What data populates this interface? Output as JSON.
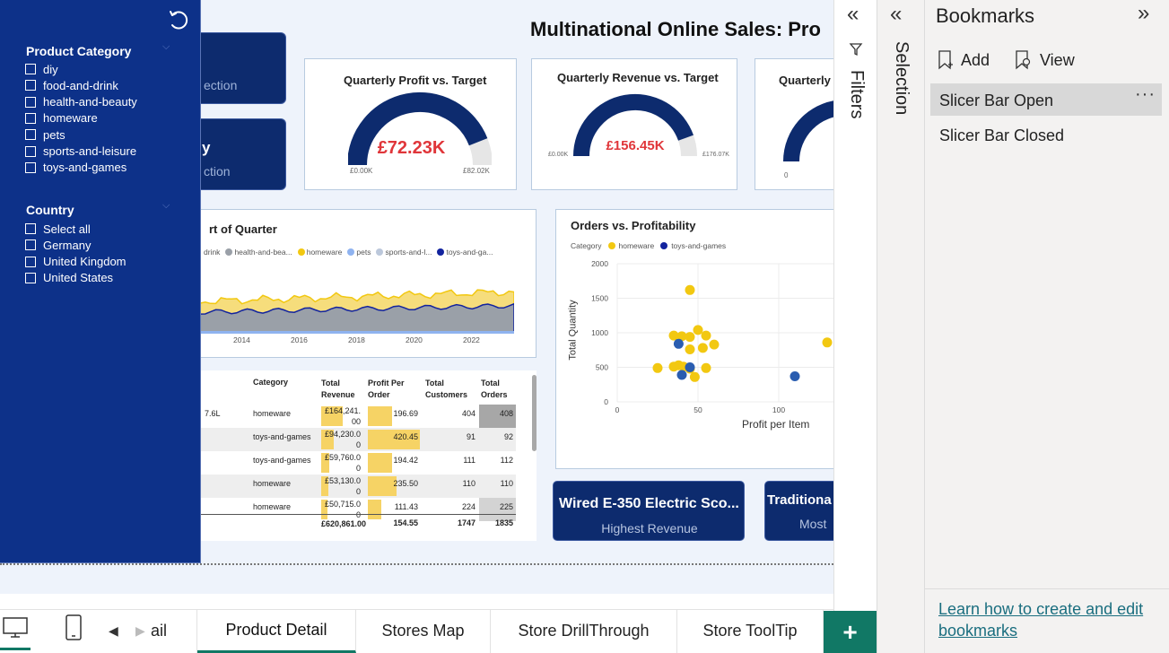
{
  "report": {
    "title_visible": "Multinational Online Sales: Pro",
    "nav_btn1_text": "ection",
    "nav_btn2_big": "y",
    "nav_btn2_text": "ction"
  },
  "slicer": {
    "category_title": "Product Category",
    "categories": [
      "diy",
      "food-and-drink",
      "health-and-beauty",
      "homeware",
      "pets",
      "sports-and-leisure",
      "toys-and-games"
    ],
    "country_title": "Country",
    "countries": [
      "Select all",
      "Germany",
      "United Kingdom",
      "United States"
    ]
  },
  "gauges": [
    {
      "title": "Quarterly Profit vs. Target",
      "value": "£72.23K",
      "min": "£0.00K",
      "max": "£82.02K",
      "fraction": 0.88
    },
    {
      "title": "Quarterly Revenue vs. Target",
      "value": "£156.45K",
      "min": "£0.00K",
      "max": "£176.07K",
      "fraction": 0.89
    },
    {
      "title": "Quarterly",
      "min": "0",
      "fraction": 0.5
    }
  ],
  "area_chart": {
    "title_visible": "rt of Quarter",
    "legend": [
      "drink",
      "health-and-bea...",
      "homeware",
      "pets",
      "sports-and-l...",
      "toys-and-ga..."
    ],
    "legend_colors": [
      "#6b8fd6",
      "#9aa0a8",
      "#f2c811",
      "#8fb3f0",
      "#bcc8db",
      "#12239e"
    ],
    "x_ticks": [
      "2014",
      "2016",
      "2018",
      "2020",
      "2022"
    ]
  },
  "table": {
    "headers": {
      "category": "Category",
      "revenue": "Total Revenue",
      "profit": "Profit Per Order",
      "customers": "Total Customers",
      "orders": "Total Orders"
    },
    "rows": [
      {
        "product": "7.6L",
        "category": "homeware",
        "revenue": "£164,241.00",
        "revenue_frac": 1.0,
        "profit": "196.69",
        "profit_frac": 0.47,
        "customers": "404",
        "orders": "408"
      },
      {
        "product": "",
        "category": "toys-and-games",
        "revenue": "£94,230.00",
        "revenue_frac": 0.57,
        "profit": "420.45",
        "profit_frac": 1.0,
        "customers": "91",
        "orders": "92"
      },
      {
        "product": "",
        "category": "toys-and-games",
        "revenue": "£59,760.00",
        "revenue_frac": 0.36,
        "profit": "194.42",
        "profit_frac": 0.46,
        "customers": "111",
        "orders": "112"
      },
      {
        "product": "",
        "category": "homeware",
        "revenue": "£53,130.00",
        "revenue_frac": 0.32,
        "profit": "235.50",
        "profit_frac": 0.56,
        "customers": "110",
        "orders": "110"
      },
      {
        "product": "",
        "category": "homeware",
        "revenue": "£50,715.00",
        "revenue_frac": 0.31,
        "profit": "111.43",
        "profit_frac": 0.26,
        "customers": "224",
        "orders": "225"
      }
    ],
    "totals": {
      "revenue": "£620,861.00",
      "profit": "154.55",
      "customers": "1747",
      "orders": "1835"
    }
  },
  "scatter": {
    "title": "Orders vs. Profitability",
    "legend_label": "Category",
    "legend": [
      {
        "name": "homeware",
        "color": "#f2c811"
      },
      {
        "name": "toys-and-games",
        "color": "#12239e"
      }
    ],
    "xlabel": "Profit per Item",
    "ylabel": "Total Quantity",
    "y_ticks": [
      "2000",
      "1500",
      "1000",
      "500",
      "0"
    ],
    "x_ticks": [
      "0",
      "50",
      "100"
    ],
    "chart_data": {
      "type": "scatter",
      "xlim": [
        0,
        140
      ],
      "ylim": [
        0,
        2000
      ],
      "series": [
        {
          "name": "homeware",
          "points": [
            [
              45,
              1620
            ],
            [
              40,
              950
            ],
            [
              45,
              940
            ],
            [
              50,
              1040
            ],
            [
              55,
              960
            ],
            [
              60,
              830
            ],
            [
              53,
              780
            ],
            [
              45,
              760
            ],
            [
              35,
              960
            ],
            [
              38,
              530
            ],
            [
              41,
              510
            ],
            [
              35,
              510
            ],
            [
              25,
              490
            ],
            [
              45,
              480
            ],
            [
              55,
              490
            ],
            [
              48,
              360
            ],
            [
              130,
              860
            ]
          ]
        },
        {
          "name": "toys-and-games",
          "points": [
            [
              38,
              840
            ],
            [
              45,
              500
            ],
            [
              40,
              390
            ],
            [
              110,
              370
            ]
          ]
        }
      ]
    }
  },
  "cards": [
    {
      "value": "Wired E-350 Electric Sco...",
      "label": "Highest Revenue"
    },
    {
      "value": "Traditiona",
      "label": "Most"
    }
  ],
  "panes": {
    "filters_label": "Filters",
    "selection_label": "Selection",
    "bookmarks_title": "Bookmarks",
    "add_label": "Add",
    "view_label": "View",
    "bookmarks": [
      "Slicer Bar Open",
      "Slicer Bar Closed"
    ],
    "learn_link": "Learn how to create and edit bookmarks"
  },
  "tabs": [
    "ail",
    "Product Detail",
    "Stores Map",
    "Store DrillThrough",
    "Store ToolTip"
  ],
  "add_tab": "+"
}
